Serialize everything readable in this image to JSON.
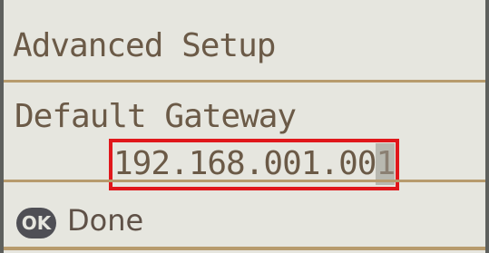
{
  "screen": {
    "title": "Advanced Setup",
    "subtitle": "Default Gateway"
  },
  "field": {
    "value_prefix": "192.168.001.00",
    "value_cursor_char": "1"
  },
  "footer": {
    "ok_key_label": "OK",
    "done_label": "Done"
  },
  "colors": {
    "lcd_background": "#e6e6df",
    "lcd_text": "#6b5a47",
    "rule": "#b79b6d",
    "highlight_box": "#e0171b",
    "ok_key": "#4f4f55"
  },
  "icons": {
    "ok_key": "ok-button-icon"
  }
}
